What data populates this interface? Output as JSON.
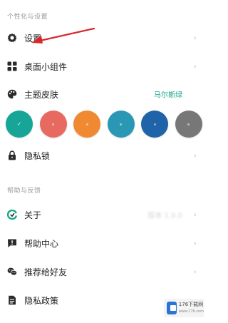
{
  "personalization": {
    "header": "个性化与设置",
    "settings_label": "设置",
    "widgets_label": "桌面小组件",
    "theme_label": "主题皮肤",
    "theme_value": "马尔斯绿",
    "theme_value_color": "#1aa58a",
    "swatches": [
      {
        "name": "teal",
        "color": "#16a597",
        "selected": true
      },
      {
        "name": "red",
        "color": "#e8695f",
        "selected": false
      },
      {
        "name": "orange",
        "color": "#ef8a32",
        "selected": false
      },
      {
        "name": "cyan-blue",
        "color": "#2a97b5",
        "selected": false
      },
      {
        "name": "blue",
        "color": "#1f63a8",
        "selected": false
      },
      {
        "name": "gray",
        "color": "#777777",
        "selected": false
      }
    ],
    "privacy_lock_label": "隐私锁"
  },
  "help": {
    "header": "帮助与反馈",
    "about_label": "关于",
    "about_value": "版本 1.0.0",
    "help_center_label": "帮助中心",
    "recommend_label": "推荐给好友",
    "privacy_policy_label": "隐私政策"
  },
  "watermark": {
    "text": "176下载网",
    "url": "www.176.com"
  },
  "icons": {
    "chevron": "›",
    "check": "✓"
  }
}
